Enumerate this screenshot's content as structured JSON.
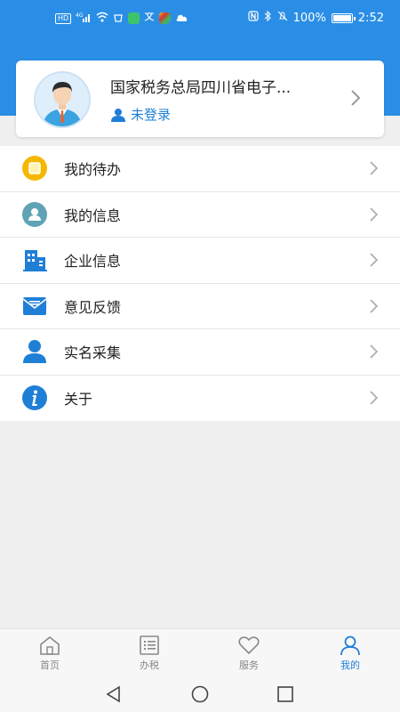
{
  "status_bar": {
    "left_badges": [
      "HD",
      "4G"
    ],
    "battery_text": "100%",
    "time": "2:52"
  },
  "profile": {
    "name": "国家税务总局四川省电子...",
    "login_status": "未登录"
  },
  "menu": {
    "items": [
      {
        "label": "我的待办",
        "icon": "todo-icon",
        "color": "#f5b800"
      },
      {
        "label": "我的信息",
        "icon": "user-info-icon",
        "color": "#5fa3b5"
      },
      {
        "label": "企业信息",
        "icon": "building-icon",
        "color": "#1f7fd6"
      },
      {
        "label": "意见反馈",
        "icon": "mail-icon",
        "color": "#1f7fd6"
      },
      {
        "label": "实名采集",
        "icon": "person-icon",
        "color": "#1f7fd6"
      },
      {
        "label": "关于",
        "icon": "info-icon",
        "color": "#1f7fd6"
      }
    ]
  },
  "tabbar": {
    "tabs": [
      {
        "label": "首页",
        "icon": "home-icon"
      },
      {
        "label": "办税",
        "icon": "list-icon"
      },
      {
        "label": "服务",
        "icon": "heart-icon"
      },
      {
        "label": "我的",
        "icon": "me-icon"
      }
    ],
    "active_index": 3
  },
  "colors": {
    "header": "#2b8ee6",
    "accent": "#1f7fd6",
    "background": "#efefef"
  }
}
